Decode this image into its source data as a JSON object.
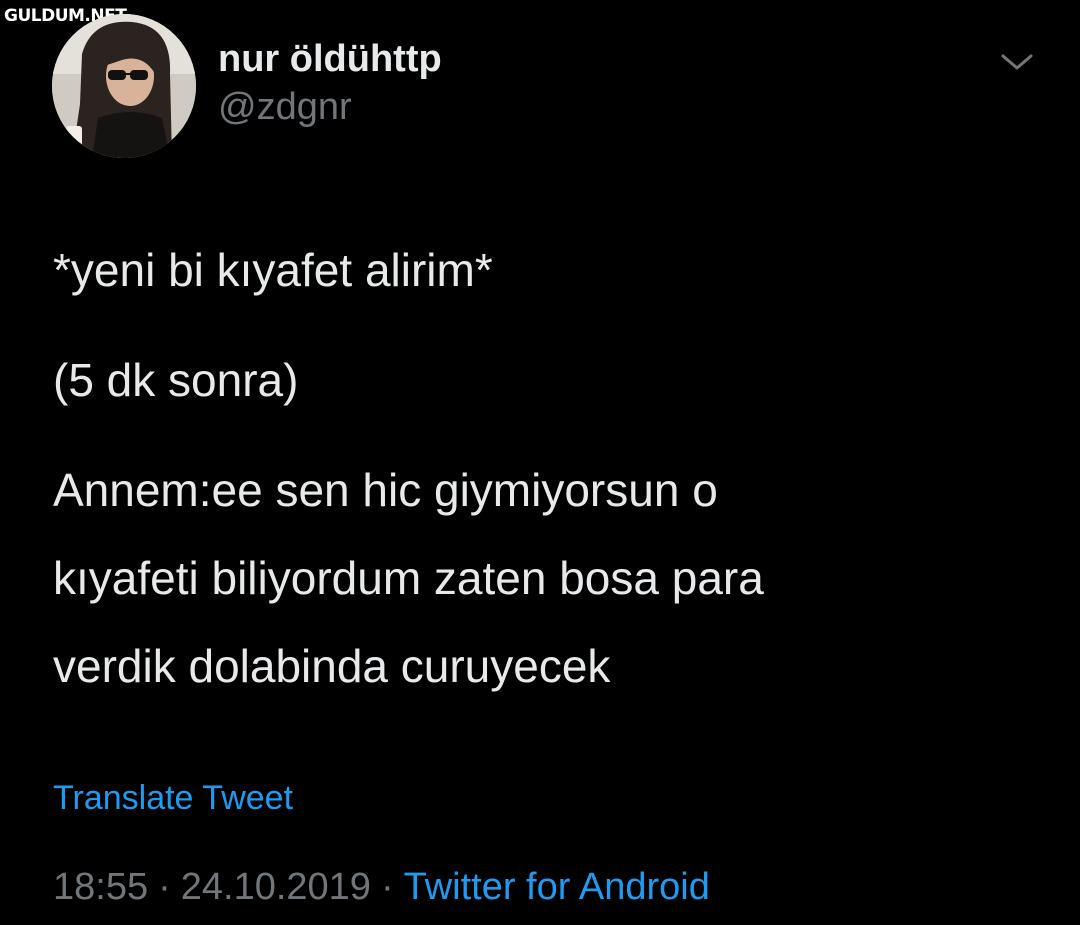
{
  "watermark": "GULDUM.NET",
  "user": {
    "display_name": "nur öldühttp",
    "handle": "@zdgnr"
  },
  "tweet": {
    "line1": "*yeni bi kıyafet alirim*",
    "line2": "(5 dk sonra)",
    "line3": [
      "Annem:ee sen hic giymiyorsun o",
      "kıyafeti biliyordum zaten bosa para",
      "verdik dolabinda curuyecek"
    ]
  },
  "translate_label": "Translate Tweet",
  "meta": {
    "time": "18:55",
    "date": "24.10.2019",
    "separator": "·",
    "source": "Twitter for Android"
  },
  "icons": {
    "caret": "chevron-down-icon",
    "avatar": "profile-photo"
  },
  "colors": {
    "background": "#000000",
    "text": "#e7e9ea",
    "secondary": "#71767b",
    "link": "#1d9bf0"
  }
}
